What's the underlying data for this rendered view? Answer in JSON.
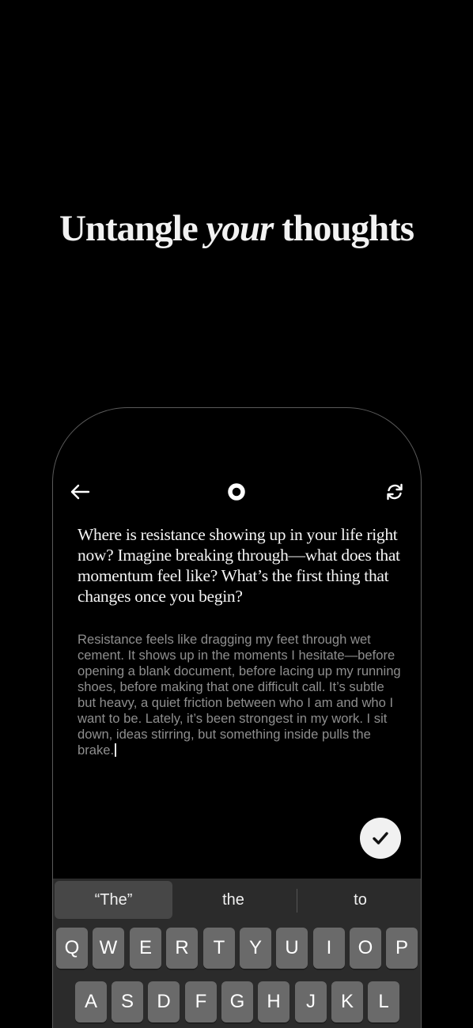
{
  "headline": {
    "part1": "Untangle ",
    "part2": "your",
    "part3": " thoughts"
  },
  "topbar": {
    "back_icon": "arrow-left-icon",
    "record_icon": "record-circle-icon",
    "refresh_icon": "refresh-icon"
  },
  "prompt": "Where is resistance showing up in your life right now? Imagine breaking through—what does that momentum feel like? What’s the first thing that changes once you begin?",
  "entry": "Resistance feels like dragging my feet through wet cement. It shows up in the moments I hesitate—before opening a blank document, before lacing up my running shoes, before making that one difficult call. It’s subtle but heavy, a quiet friction between who I am and who I want to be. Lately, it’s been strongest in my work. I sit down, ideas stirring, but something inside pulls the brake.",
  "done_icon": "checkmark-icon",
  "keyboard": {
    "suggestions": [
      "“The”",
      "the",
      "to"
    ],
    "row1": [
      "Q",
      "W",
      "E",
      "R",
      "T",
      "Y",
      "U",
      "I",
      "O",
      "P"
    ],
    "row2": [
      "A",
      "S",
      "D",
      "F",
      "G",
      "H",
      "J",
      "K",
      "L"
    ]
  },
  "colors": {
    "background": "#000000",
    "keyboard_bg": "#2b2b2b",
    "key_bg": "#6a6a6a",
    "entry_text": "#8e8e8e",
    "done_button": "#f1f1f1"
  }
}
